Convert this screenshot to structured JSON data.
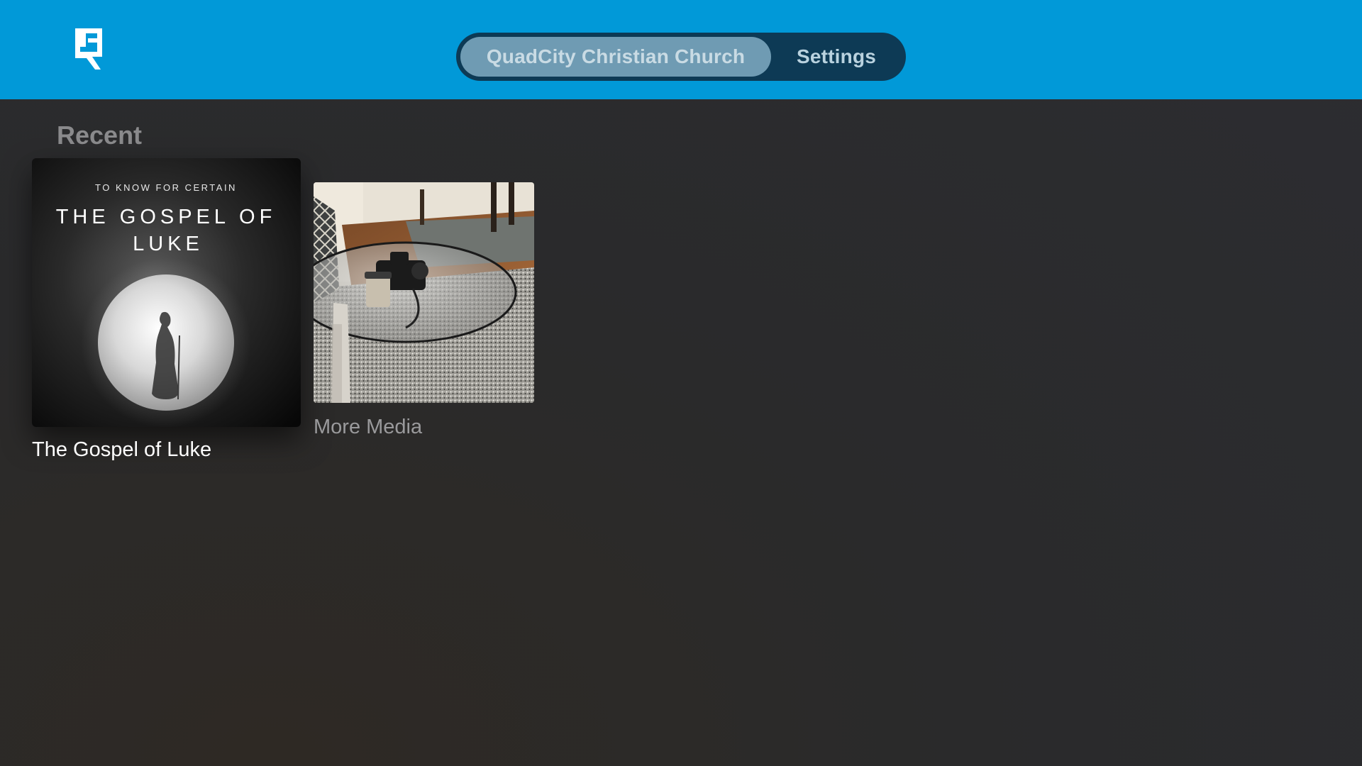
{
  "header": {
    "logo_icon": "church-logo-icon",
    "tabs": [
      {
        "label": "QuadCity Christian Church",
        "selected": true
      },
      {
        "label": "Settings",
        "selected": false
      }
    ],
    "bar_color": "#0199d8"
  },
  "recent": {
    "title": "Recent",
    "items": [
      {
        "caption": "The Gospel of Luke",
        "artwork": {
          "kicker": "TO KNOW FOR CERTAIN",
          "title_line1": "THE GOSPEL OF",
          "title_line2": "LUKE"
        }
      },
      {
        "caption": "More Media",
        "artwork_icon": "living-room-photo"
      }
    ]
  }
}
